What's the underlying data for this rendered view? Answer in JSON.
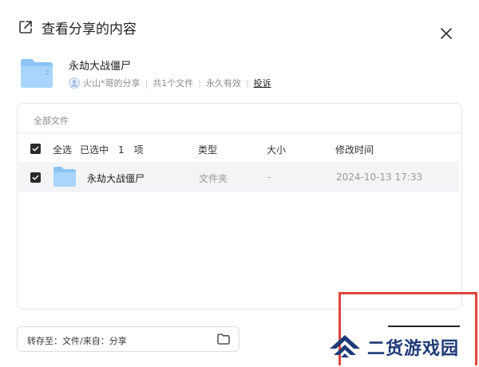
{
  "dialog": {
    "title": "查看分享的内容",
    "icons": {
      "header": "share-external-icon",
      "close": "close-icon"
    }
  },
  "share": {
    "name": "永劫大战僵尸",
    "sharer": "火山*哥的分享",
    "file_count": "共1个文件",
    "validity": "永久有效",
    "report_label": "投诉"
  },
  "panel": {
    "breadcrumb": "全部文件",
    "header": {
      "select_all": "全选",
      "selected": "已选中　1　项",
      "col_type": "类型",
      "col_size": "大小",
      "col_time": "修改时间"
    },
    "rows": [
      {
        "name": "永劫大战僵尸",
        "type": "文件夹",
        "size": "-",
        "time": "2024-10-13 17:33",
        "checked": true
      }
    ]
  },
  "save_to": {
    "label": "转存至：文件/来自：分享"
  },
  "watermark": {
    "text": "二货游戏园"
  },
  "colors": {
    "folder": "#8cc5f5",
    "checkbox": "#2a2a2a",
    "highlight": "#e0453a",
    "watermark": "#1e3a78"
  }
}
